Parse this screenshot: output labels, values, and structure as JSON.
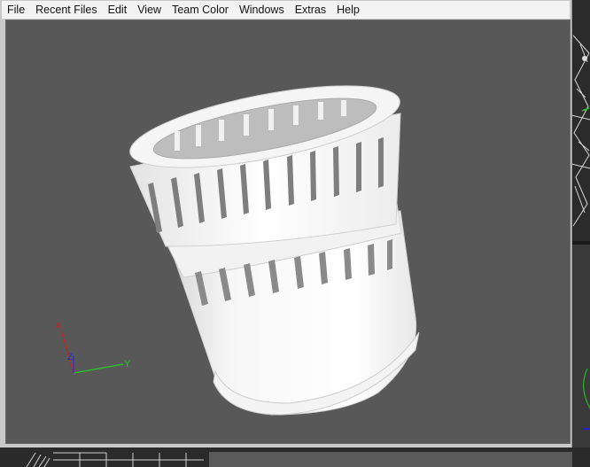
{
  "menu": {
    "items": [
      "File",
      "Recent Files",
      "Edit",
      "View",
      "Team Color",
      "Windows",
      "Extras",
      "Help"
    ]
  },
  "viewport": {
    "background": "#585858",
    "model": "white cylindrical cup with slotted rim, shaded render",
    "axes": {
      "x_label": "X",
      "y_label": "Y",
      "z_label": "Z",
      "x_color": "#cc2222",
      "y_color": "#22cc22",
      "z_color": "#2233cc"
    }
  }
}
